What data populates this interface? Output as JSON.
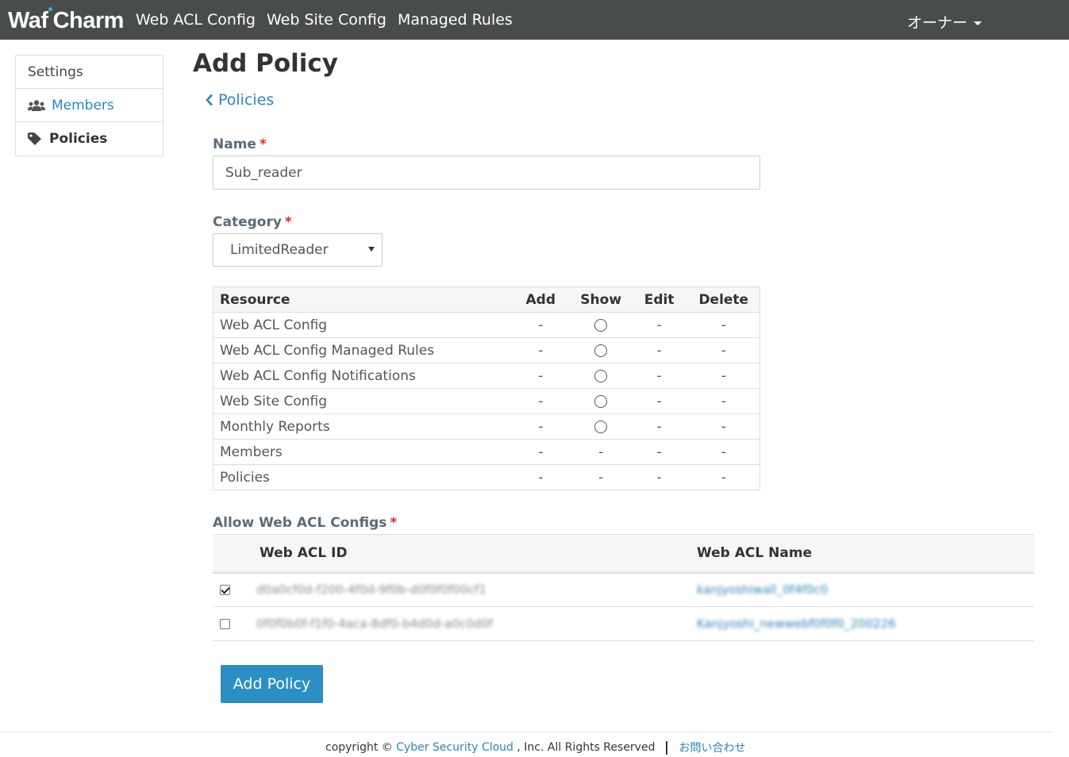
{
  "navbar": {
    "brand_part1": "Waf",
    "brand_part2": "Charm",
    "links": [
      "Web ACL Config",
      "Web Site Config",
      "Managed Rules"
    ],
    "user_menu": "オーナー"
  },
  "sidebar": {
    "heading": "Settings",
    "items": [
      {
        "label": "Members",
        "icon": "users-icon",
        "active": false
      },
      {
        "label": "Policies",
        "icon": "tag-icon",
        "active": true
      }
    ]
  },
  "page": {
    "title": "Add Policy",
    "back_link": "Policies"
  },
  "form": {
    "name_label": "Name",
    "name_value": "Sub_reader",
    "category_label": "Category",
    "category_value": "LimitedReader",
    "required_mark": "*",
    "submit_label": "Add Policy"
  },
  "permissions": {
    "columns": [
      "Resource",
      "Add",
      "Show",
      "Edit",
      "Delete"
    ],
    "rows": [
      {
        "resource": "Web ACL Config",
        "add": "-",
        "show": "radio",
        "edit": "-",
        "delete": "-"
      },
      {
        "resource": "Web ACL Config Managed Rules",
        "add": "-",
        "show": "radio",
        "edit": "-",
        "delete": "-"
      },
      {
        "resource": "Web ACL Config Notifications",
        "add": "-",
        "show": "radio",
        "edit": "-",
        "delete": "-"
      },
      {
        "resource": "Web Site Config",
        "add": "-",
        "show": "radio",
        "edit": "-",
        "delete": "-"
      },
      {
        "resource": "Monthly Reports",
        "add": "-",
        "show": "radio",
        "edit": "-",
        "delete": "-"
      },
      {
        "resource": "Members",
        "add": "-",
        "show": "-",
        "edit": "-",
        "delete": "-"
      },
      {
        "resource": "Policies",
        "add": "-",
        "show": "-",
        "edit": "-",
        "delete": "-"
      }
    ]
  },
  "web_acl_configs": {
    "label": "Allow Web ACL Configs",
    "columns": [
      "",
      "Web ACL ID",
      "Web ACL Name"
    ],
    "rows": [
      {
        "checked": true,
        "id": "d0a0cf0d-f200-4f0d-9f0b-d0f0f0f00cf1",
        "name": "kanjyoshiwall_0f4f0c0"
      },
      {
        "checked": false,
        "id": "0f0f0b0f-f1f0-4aca-8df0-b4d0d-a0c0d0f",
        "name": "Kanjyoshi_newwebf0f0f0_200226"
      }
    ]
  },
  "footer": {
    "copyright_prefix": "copyright ©",
    "company": "Cyber Security Cloud",
    "rights": ", Inc. All Rights Reserved",
    "contact": "お問い合わせ"
  }
}
